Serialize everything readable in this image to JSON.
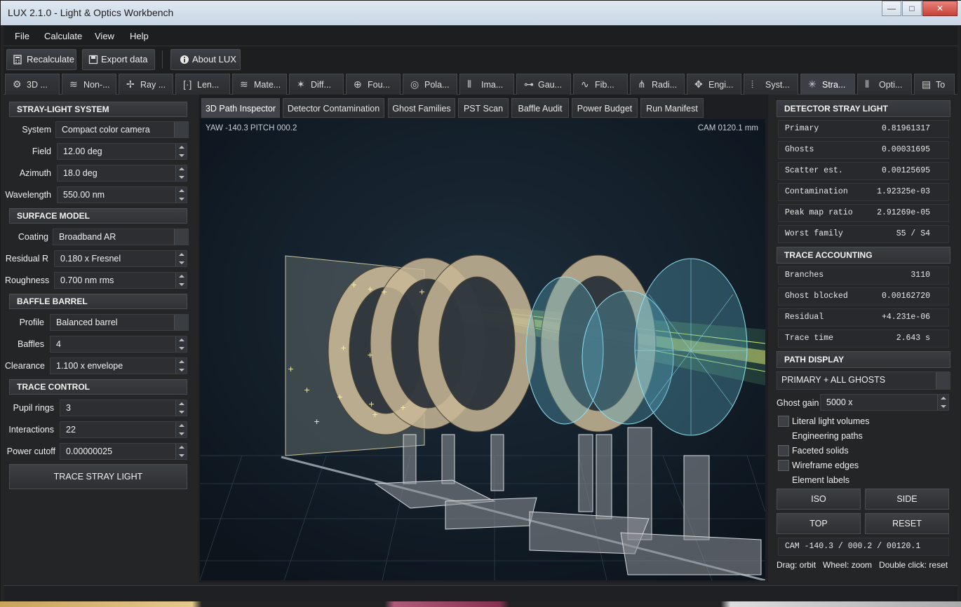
{
  "window": {
    "title": "LUX 2.1.0 - Light & Optics Workbench",
    "min": "—",
    "max": "□",
    "close": "✕"
  },
  "menu": [
    "File",
    "Calculate",
    "View",
    "Help"
  ],
  "toolbar": {
    "recalculate": "Recalculate",
    "export": "Export data",
    "about": "About LUX"
  },
  "tabs": [
    {
      "label": "3D ...",
      "icon": "gear-icon"
    },
    {
      "label": "Non-...",
      "icon": "wave-icon"
    },
    {
      "label": "Ray ...",
      "icon": "ray-icon"
    },
    {
      "label": "Len...",
      "icon": "bracket-icon"
    },
    {
      "label": "Mate...",
      "icon": "wave-icon"
    },
    {
      "label": "Diff...",
      "icon": "diffraction-icon"
    },
    {
      "label": "Fou...",
      "icon": "crosshair-icon"
    },
    {
      "label": "Pola...",
      "icon": "target-icon"
    },
    {
      "label": "Ima...",
      "icon": "bars-icon"
    },
    {
      "label": "Gau...",
      "icon": "beam-icon"
    },
    {
      "label": "Fib...",
      "icon": "fiber-icon"
    },
    {
      "label": "Radi...",
      "icon": "radiometry-icon"
    },
    {
      "label": "Engi...",
      "icon": "engine-icon"
    },
    {
      "label": "Syst...",
      "icon": "system-icon"
    },
    {
      "label": "Stra...",
      "icon": "stray-icon",
      "active": true
    },
    {
      "label": "Opti...",
      "icon": "optics-icon"
    },
    {
      "label": "To",
      "icon": "tool-icon"
    }
  ],
  "left": {
    "sections": {
      "system": "STRAY-LIGHT SYSTEM",
      "surface": "SURFACE MODEL",
      "baffle": "BAFFLE BARREL",
      "trace": "TRACE CONTROL"
    },
    "fields": {
      "system_label": "System",
      "system_value": "Compact color camera",
      "field_label": "Field",
      "field_value": "12.00 deg",
      "azimuth_label": "Azimuth",
      "azimuth_value": "18.0 deg",
      "wavelength_label": "Wavelength",
      "wavelength_value": "550.00 nm",
      "coating_label": "Coating",
      "coating_value": "Broadband AR",
      "residual_label": "Residual R",
      "residual_value": "0.180 x Fresnel",
      "roughness_label": "Roughness",
      "roughness_value": "0.700 nm rms",
      "profile_label": "Profile",
      "profile_value": "Balanced barrel",
      "baffles_label": "Baffles",
      "baffles_value": "4",
      "clearance_label": "Clearance",
      "clearance_value": "1.100 x envelope",
      "pupil_label": "Pupil rings",
      "pupil_value": "3",
      "interactions_label": "Interactions",
      "interactions_value": "22",
      "cutoff_label": "Power cutoff",
      "cutoff_value": "0.00000025"
    },
    "trace_button": "TRACE STRAY LIGHT"
  },
  "subtabs": [
    "3D Path Inspector",
    "Detector Contamination",
    "Ghost Families",
    "PST Scan",
    "Baffle Audit",
    "Power Budget",
    "Run Manifest"
  ],
  "viewport": {
    "orientation": "YAW -140.3   PITCH 000.2",
    "cam": "CAM 0120.1 mm"
  },
  "right": {
    "detector_title": "DETECTOR STRAY LIGHT",
    "detector": [
      {
        "k": "Primary",
        "v": "0.81961317"
      },
      {
        "k": "Ghosts",
        "v": "0.00031695"
      },
      {
        "k": "Scatter est.",
        "v": "0.00125695"
      },
      {
        "k": "Contamination",
        "v": "1.92325e-03"
      },
      {
        "k": "Peak map ratio",
        "v": "2.91269e-05"
      },
      {
        "k": "Worst family",
        "v": "S5 / S4"
      }
    ],
    "trace_title": "TRACE ACCOUNTING",
    "trace": [
      {
        "k": "Branches",
        "v": "3110"
      },
      {
        "k": "Ghost blocked",
        "v": "0.00162720"
      },
      {
        "k": "Residual",
        "v": "+4.231e-06"
      },
      {
        "k": "Trace time",
        "v": "2.643 s"
      }
    ],
    "path_title": "PATH DISPLAY",
    "path_mode": "PRIMARY + ALL GHOSTS",
    "ghost_gain_label": "Ghost gain",
    "ghost_gain_value": "5000 x",
    "checks": [
      {
        "label": "Literal light volumes",
        "checked": false
      },
      {
        "label": "Engineering paths",
        "checked": false
      },
      {
        "label": "Faceted solids",
        "checked": false
      },
      {
        "label": "Wireframe edges",
        "checked": false
      },
      {
        "label": "Element labels",
        "checked": false
      }
    ],
    "views": [
      "ISO",
      "SIDE",
      "TOP",
      "RESET"
    ],
    "cam_readout": "CAM -140.3 / 000.2 / 00120.1",
    "hint": "Drag: orbit   Wheel: zoom   Double click: reset"
  }
}
